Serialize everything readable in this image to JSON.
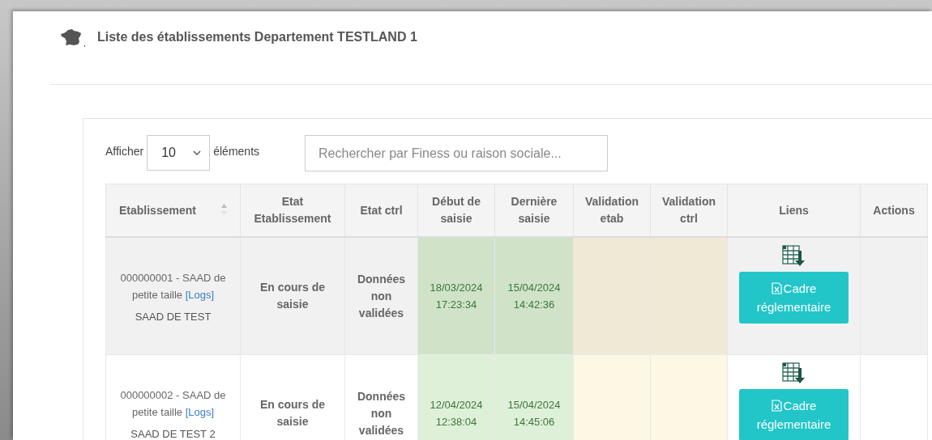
{
  "header": {
    "title": "Liste des établissements Departement TESTLAND 1"
  },
  "controls": {
    "show_label": "Afficher",
    "page_size": "10",
    "show_suffix": "éléments",
    "search": {
      "placeholder": "Rechercher par Finess ou raison sociale..."
    }
  },
  "table": {
    "columns": [
      {
        "label": "Etablissement",
        "kind": "text",
        "sortable": true
      },
      {
        "label": "Etat Etablissement",
        "kind": "bold",
        "sortable": false
      },
      {
        "label": "Etat ctrl",
        "kind": "bold",
        "sortable": false
      },
      {
        "label": "Début de saisie",
        "kind": "date",
        "sortable": false
      },
      {
        "label": "Dernière saisie",
        "kind": "date",
        "sortable": false
      },
      {
        "label": "Validation etab",
        "kind": "pending",
        "sortable": false
      },
      {
        "label": "Validation ctrl",
        "kind": "pending",
        "sortable": false
      },
      {
        "label": "Liens",
        "kind": "links",
        "sortable": false
      },
      {
        "label": "Actions",
        "kind": "actions",
        "sortable": false
      }
    ],
    "rows": [
      {
        "highlighted": true,
        "finess": "000000001 - SAAD de petite taille",
        "logs_link": "[Logs]",
        "name": "SAAD DE TEST",
        "etat_etab": "En cours de saisie",
        "etat_ctrl": "Données non validées",
        "debut": "18/03/2024 17:23:34",
        "derniere": "15/04/2024 14:42:36",
        "button": "Cadre réglementaire"
      },
      {
        "highlighted": false,
        "finess": "000000002 - SAAD de petite taille",
        "logs_link": "[Logs]",
        "name": "SAAD DE TEST 2",
        "etat_etab": "En cours de saisie",
        "etat_ctrl": "Données non validées",
        "debut": "12/04/2024 12:38:04",
        "derniere": "15/04/2024 14:45:06",
        "button": "Cadre réglementaire"
      }
    ]
  }
}
